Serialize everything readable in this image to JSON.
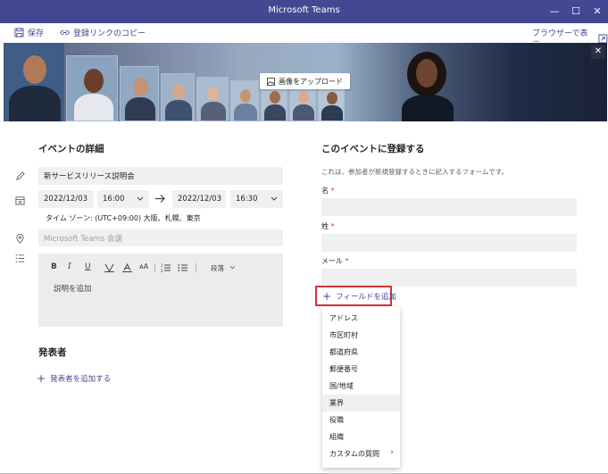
{
  "window": {
    "title": "Microsoft Teams"
  },
  "toolbar": {
    "save": "保存",
    "copy_link": "登録リンクのコピー",
    "browser": "ブラウザーで表示"
  },
  "banner": {
    "upload": "画像をアップロード"
  },
  "details": {
    "heading": "イベントの詳細",
    "event_title": "新サービスリリース説明会",
    "start_date": "2022/12/03",
    "start_time": "16:00",
    "end_date": "2022/12/03",
    "end_time": "16:30",
    "timezone": "タイム ゾーン: (UTC+09:00) 大阪、札幌、東京",
    "location_placeholder": "Microsoft Teams 会議",
    "editor": {
      "bold": "B",
      "italic": "I",
      "underline": "U",
      "font_size": "ᴀA",
      "paragraph": "段落",
      "placeholder": "説明を追加"
    }
  },
  "presenters": {
    "heading": "発表者",
    "add": "発表者を追加する"
  },
  "registration": {
    "heading": "このイベントに登録する",
    "note": "これは、参加者が新規登録するときに記入するフォームです。",
    "fields": [
      {
        "label": "名",
        "required": "*"
      },
      {
        "label": "姓",
        "required": "*"
      },
      {
        "label": "メール",
        "required": "*"
      }
    ],
    "add_field": "フィールドを追加",
    "menu": [
      "アドレス",
      "市区町村",
      "都道府県",
      "郵便番号",
      "国/地域",
      "業界",
      "役職",
      "組織",
      "カスタムの質問"
    ]
  }
}
